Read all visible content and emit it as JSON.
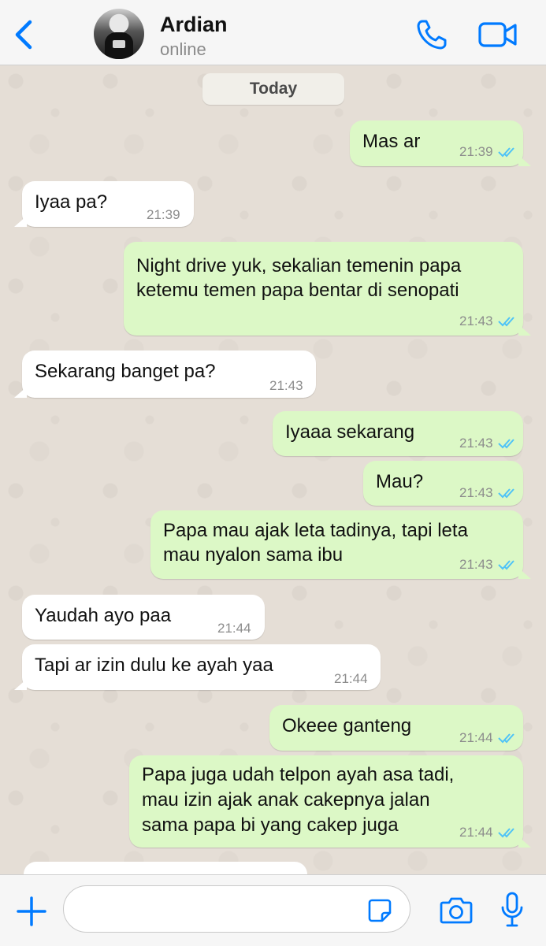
{
  "header": {
    "contact_name": "Ardian",
    "contact_status": "online"
  },
  "chat": {
    "date_label": "Today",
    "messages": [
      {
        "direction": "out",
        "text_lines": [
          "Mas ar"
        ],
        "time": "21:39",
        "status": "read"
      },
      {
        "direction": "in",
        "text_lines": [
          "Iyaa pa?"
        ],
        "time": "21:39"
      },
      {
        "direction": "out",
        "text_lines": [
          "Night drive yuk, sekalian temenin papa",
          "ketemu temen papa bentar di senopati"
        ],
        "time": "21:43",
        "status": "read"
      },
      {
        "direction": "in",
        "text_lines": [
          "Sekarang banget pa?"
        ],
        "time": "21:43"
      },
      {
        "direction": "out",
        "text_lines": [
          "Iyaaa sekarang"
        ],
        "time": "21:43",
        "status": "read"
      },
      {
        "direction": "out",
        "text_lines": [
          "Mau?"
        ],
        "time": "21:43",
        "status": "read"
      },
      {
        "direction": "out",
        "text_lines": [
          "Papa mau ajak leta tadinya, tapi leta",
          "mau nyalon sama ibu"
        ],
        "time": "21:43",
        "status": "read"
      },
      {
        "direction": "in",
        "text_lines": [
          "Yaudah ayo paa"
        ],
        "time": "21:44"
      },
      {
        "direction": "in",
        "text_lines": [
          "Tapi ar izin dulu ke ayah yaa"
        ],
        "time": "21:44"
      },
      {
        "direction": "out",
        "text_lines": [
          "Okeee ganteng"
        ],
        "time": "21:44",
        "status": "read"
      },
      {
        "direction": "out",
        "text_lines": [
          "Papa juga udah telpon ayah asa tadi,",
          "mau izin ajak anak cakepnya jalan",
          "sama papa bi yang cakep juga"
        ],
        "time": "21:44",
        "status": "read"
      }
    ]
  },
  "composer": {
    "value": ""
  },
  "colors": {
    "accent": "#007aff",
    "outgoing_bubble": "#dcf8c6",
    "incoming_bubble": "#ffffff",
    "read_tick": "#4fc3f7",
    "wallpaper": "#e5ded6"
  },
  "icons": {
    "back": "chevron-left-icon",
    "call": "phone-icon",
    "video": "video-camera-icon",
    "plus": "plus-icon",
    "sticker": "sticker-icon",
    "camera": "camera-icon",
    "mic": "microphone-icon",
    "read": "double-check-icon"
  }
}
